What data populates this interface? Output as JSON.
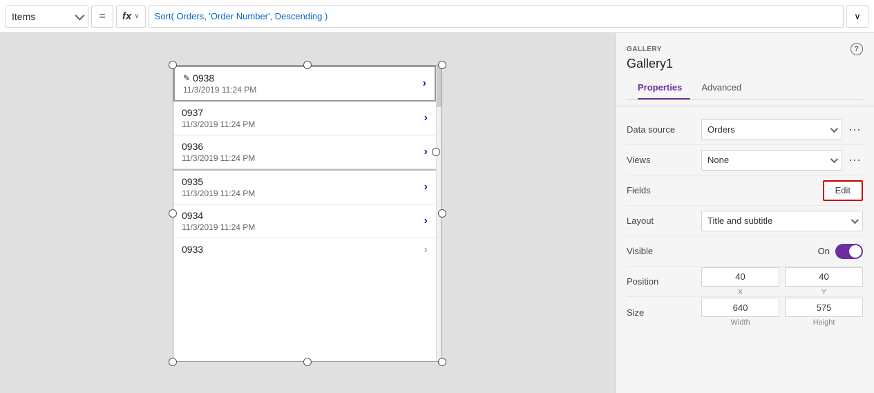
{
  "topbar": {
    "items_label": "Items",
    "equals_symbol": "=",
    "fx_label": "fx",
    "fx_chevron": "v",
    "formula": "Sort( Orders, 'Order Number', Descending )",
    "expand_label": "⌄"
  },
  "gallery": {
    "items": [
      {
        "id": 1,
        "title": "0938",
        "subtitle": "11/3/2019 11:24 PM",
        "selected": true,
        "has_pencil": true
      },
      {
        "id": 2,
        "title": "0937",
        "subtitle": "11/3/2019 11:24 PM",
        "selected": false,
        "has_pencil": false
      },
      {
        "id": 3,
        "title": "0936",
        "subtitle": "11/3/2019 11:24 PM",
        "selected": false,
        "has_pencil": false
      },
      {
        "id": 4,
        "title": "0935",
        "subtitle": "11/3/2019 11:24 PM",
        "selected": false,
        "has_pencil": false
      },
      {
        "id": 5,
        "title": "0934",
        "subtitle": "11/3/2019 11:24 PM",
        "selected": false,
        "has_pencil": false
      },
      {
        "id": 6,
        "title": "0933",
        "subtitle": "",
        "selected": false,
        "has_pencil": false
      }
    ]
  },
  "panel": {
    "section_label": "GALLERY",
    "component_name": "Gallery1",
    "help_icon": "?",
    "tabs": [
      {
        "id": "properties",
        "label": "Properties",
        "active": true
      },
      {
        "id": "advanced",
        "label": "Advanced",
        "active": false
      }
    ],
    "rows": [
      {
        "id": "data-source",
        "label": "Data source",
        "dropdown_value": "Orders",
        "has_more": true,
        "type": "dropdown"
      },
      {
        "id": "views",
        "label": "Views",
        "dropdown_value": "None",
        "has_more": true,
        "type": "dropdown"
      },
      {
        "id": "fields",
        "label": "Fields",
        "btn_label": "Edit",
        "type": "edit-btn"
      },
      {
        "id": "layout",
        "label": "Layout",
        "dropdown_value": "Title and subtitle",
        "has_more": false,
        "type": "dropdown"
      },
      {
        "id": "visible",
        "label": "Visible",
        "toggle_label": "On",
        "toggle_on": true,
        "type": "toggle"
      },
      {
        "id": "position",
        "label": "Position",
        "x_value": "40",
        "y_value": "40",
        "x_label": "X",
        "y_label": "Y",
        "type": "position"
      },
      {
        "id": "size",
        "label": "Size",
        "w_value": "640",
        "h_value": "575",
        "w_label": "Width",
        "h_label": "Height",
        "type": "size"
      }
    ],
    "colors": {
      "active_tab": "#6b2fa0",
      "toggle_on": "#6b2fa0",
      "edit_border": "#cc0000"
    }
  }
}
